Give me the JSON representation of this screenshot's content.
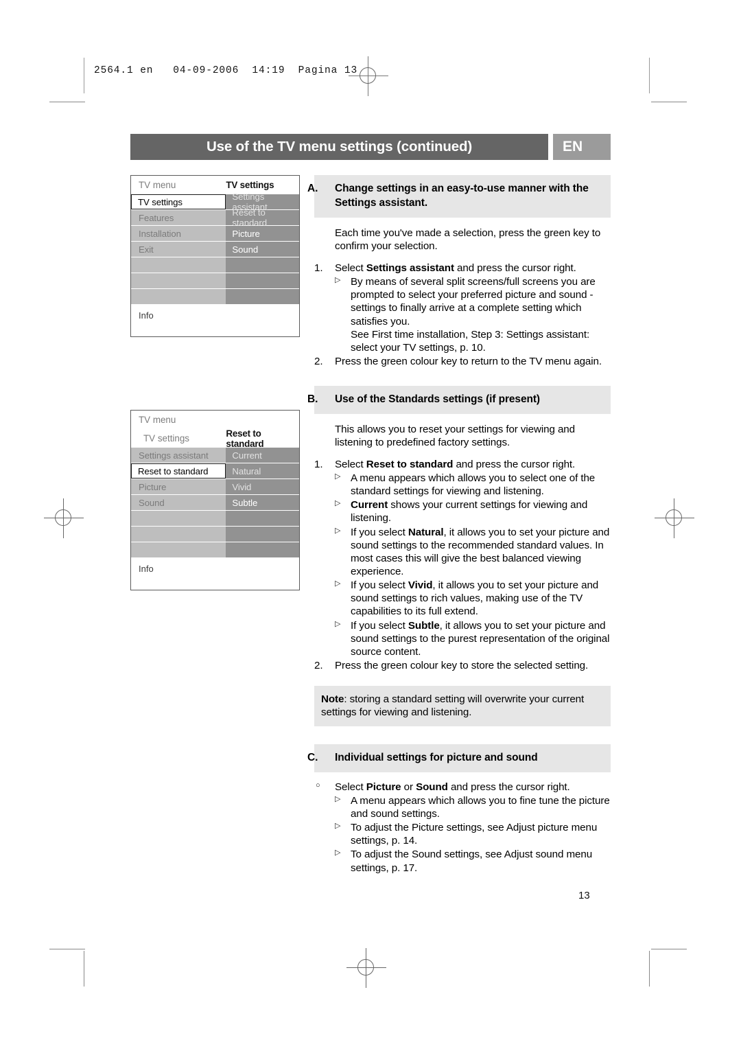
{
  "print_marks": {
    "slug_text": "2564.1 en   04-09-2006  14:19  Pagina 13"
  },
  "header": {
    "title": "Use of the TV menu settings (continued)",
    "language_badge": "EN",
    "bar_color": "#656565",
    "badge_color": "#9b9b9b"
  },
  "menu_diagram_1": {
    "header_left": "TV menu",
    "header_right": "TV settings",
    "rows": [
      {
        "left": "TV settings",
        "right": "Settings assistant",
        "selected": true
      },
      {
        "left": "Features",
        "right": "Reset to standard",
        "selected": false
      },
      {
        "left": "Installation",
        "right": "Picture",
        "selected": false
      },
      {
        "left": "Exit",
        "right": "Sound",
        "selected": false
      },
      {
        "left": "",
        "right": "",
        "selected": false
      },
      {
        "left": "",
        "right": "",
        "selected": false
      },
      {
        "left": "",
        "right": "",
        "selected": false
      }
    ],
    "info_label": "Info"
  },
  "menu_diagram_2": {
    "header_top": "TV menu",
    "header_left": "TV settings",
    "header_right": "Reset to standard",
    "rows": [
      {
        "left": "Settings assistant",
        "right": "Current",
        "selected": false
      },
      {
        "left": "Reset to standard",
        "right": "Natural",
        "selected": true
      },
      {
        "left": "Picture",
        "right": "Vivid",
        "selected": false
      },
      {
        "left": "Sound",
        "right": "Subtle",
        "selected": false
      },
      {
        "left": "",
        "right": "",
        "selected": false
      },
      {
        "left": "",
        "right": "",
        "selected": false
      },
      {
        "left": "",
        "right": "",
        "selected": false
      }
    ],
    "info_label": "Info"
  },
  "section_a": {
    "label": "A.",
    "heading_line1": "Change settings in an easy-to-use manner with the",
    "heading_line2": "Settings assistant.",
    "intro": "Each time you've made a selection, press the green key to confirm your selection.",
    "step1_num": "1.",
    "step1_pre": "Select ",
    "step1_bold": "Settings assistant",
    "step1_post": " and press the cursor right.",
    "bullet1": "By means of several split screens/full screens you are prompted to select your preferred picture and sound - settings to finally arrive at a complete setting which satisfies you.",
    "bullet1_cont": "See First time installation, Step 3: Settings assistant: select your TV settings, p. 10.",
    "step2_num": "2.",
    "step2": "Press the green colour key to return to the TV menu again."
  },
  "section_b": {
    "label": "B.",
    "heading": "Use of the Standards settings (if present)",
    "intro": "This allows you to reset your settings for viewing and listening to predefined factory settings.",
    "step1_num": "1.",
    "step1_pre": "Select ",
    "step1_bold": "Reset to standard",
    "step1_post": " and press the cursor right.",
    "bullets": [
      {
        "pre": "A menu appears which allows you to select one of the standard settings for viewing and listening.",
        "bold": "",
        "post": ""
      },
      {
        "pre": "",
        "bold": "Current",
        "post": " shows your current settings for viewing and listening."
      },
      {
        "pre": "If you select ",
        "bold": "Natural",
        "post": ", it allows you to set your picture and sound settings to the recommended standard values. In most cases this will give the best balanced viewing experience."
      },
      {
        "pre": "If you select ",
        "bold": "Vivid",
        "post": ", it allows you to set your picture and sound settings to rich values, making use of the TV capabilities to its full extend."
      },
      {
        "pre": "If you select ",
        "bold": "Subtle",
        "post": ", it allows you to set your picture and sound settings to the purest representation of the original source content."
      }
    ],
    "step2_num": "2.",
    "step2": "Press the green colour key to store the selected setting."
  },
  "note": {
    "bold": "Note",
    "text": ": storing a standard setting will overwrite your current settings for viewing and listening."
  },
  "section_c": {
    "label": "C.",
    "heading": "Individual settings for picture and sound",
    "item_pre": "Select ",
    "item_bold1": "Picture",
    "item_mid": " or ",
    "item_bold2": "Sound",
    "item_post": " and press the cursor right.",
    "bullets": [
      "A menu appears which allows you to fine tune the picture and sound settings.",
      "To adjust the Picture settings, see Adjust picture menu settings, p. 14.",
      "To adjust the Sound settings, see Adjust sound menu settings, p. 17."
    ]
  },
  "folio": "13"
}
